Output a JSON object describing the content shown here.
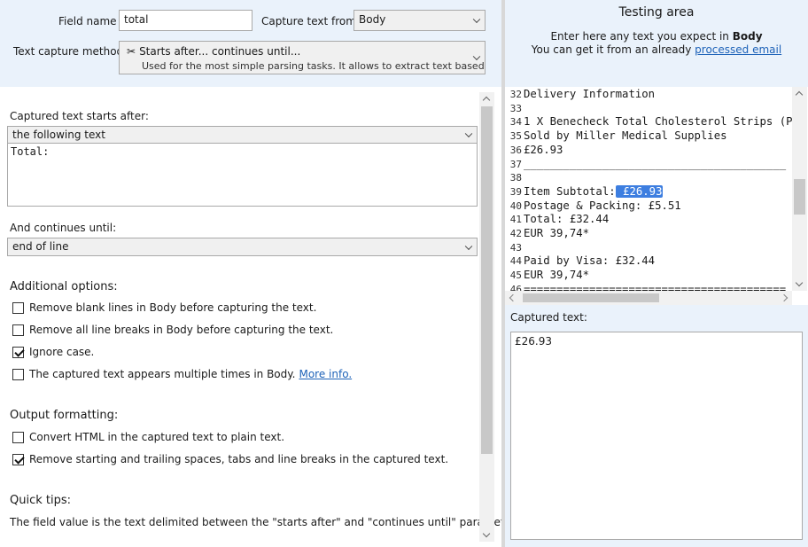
{
  "form": {
    "field_name_label": "Field name",
    "field_name_value": "total",
    "capture_from_label": "Capture text from",
    "capture_from_value": "Body",
    "method_label": "Text capture method",
    "method_title": "Starts after... continues until...",
    "method_desc": "Used for the most simple parsing tasks. It allows to extract text based on wh"
  },
  "starts": {
    "label": "Captured text starts after:",
    "select_value": "the following text",
    "text_value": "Total:"
  },
  "continues": {
    "label": "And continues until:",
    "select_value": "end of line"
  },
  "additional": {
    "title": "Additional options:",
    "options": [
      {
        "label": "Remove blank lines in Body before capturing the text.",
        "checked": false
      },
      {
        "label": "Remove all line breaks in Body before capturing the text.",
        "checked": false
      },
      {
        "label": "Ignore case.",
        "checked": true
      },
      {
        "label": "The captured text appears multiple times in Body.",
        "checked": false,
        "link": "More info."
      }
    ]
  },
  "output": {
    "title": "Output formatting:",
    "options": [
      {
        "label": "Convert HTML in the captured text to plain text.",
        "checked": false
      },
      {
        "label": "Remove starting and trailing spaces, tabs and line breaks in the captured text.",
        "checked": true
      }
    ]
  },
  "tips": {
    "title": "Quick tips:",
    "text": "The field value is the text delimited between the \"starts after\" and \"continues until\" parameters"
  },
  "testing": {
    "title": "Testing area",
    "line1_prefix": "Enter here any text you expect in ",
    "line1_bold": "Body",
    "line2_prefix": "You can get it from an already ",
    "line2_link": "processed email"
  },
  "editor": {
    "lines": [
      {
        "n": "32",
        "text": "Delivery Information"
      },
      {
        "n": "33",
        "text": ""
      },
      {
        "n": "34",
        "text": "1 X Benecheck Total Cholesterol Strips (P"
      },
      {
        "n": "35",
        "text": "Sold by Miller Medical Supplies"
      },
      {
        "n": "36",
        "text": "£26.93"
      },
      {
        "n": "37",
        "text": "________________________________________"
      },
      {
        "n": "38",
        "text": ""
      },
      {
        "n": "39",
        "text": "Item Subtotal:",
        "highlight": " £26.93"
      },
      {
        "n": "40",
        "text": "Postage & Packing: £5.51"
      },
      {
        "n": "41",
        "text": "Total: £32.44"
      },
      {
        "n": "42",
        "text": "EUR 39,74*"
      },
      {
        "n": "43",
        "text": ""
      },
      {
        "n": "44",
        "text": "Paid by Visa: £32.44"
      },
      {
        "n": "45",
        "text": "EUR 39,74*"
      },
      {
        "n": "46",
        "text": "========================================"
      }
    ]
  },
  "captured": {
    "label": "Captured text:",
    "value": "£26.93"
  }
}
